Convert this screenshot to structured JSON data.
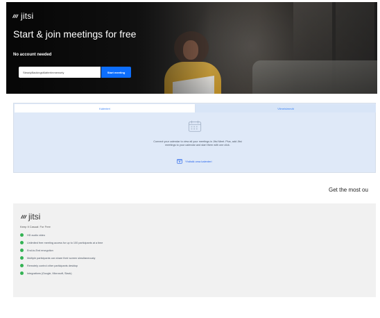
{
  "hero": {
    "brand": "jitsi",
    "title": "Start & join meetings for free",
    "subtitle": "No account needed",
    "meeting_value": "SteadyBackingsMatterImmensely",
    "start_label": "Start meeting"
  },
  "calendar_panel": {
    "tabs": [
      {
        "label": "Kalenteri",
        "active": true
      },
      {
        "label": "Viimeisimmät",
        "active": false
      }
    ],
    "message": "Connect your calendar to view all your meetings in Jitsi Meet. Plus, add Jitsi meetings to your calendar and start them with one click.",
    "connect_label": "Yhdistä oma kalenteri",
    "accent_color": "#2563eb"
  },
  "promo": {
    "heading": "Get the most ou"
  },
  "features": {
    "brand": "jitsi",
    "caption": "Keep It Casual: For Free",
    "items": [
      "HD audio video",
      "Unlimited free meeting access for up to 100 participants at a time",
      "End-to-End encryption",
      "Multiple participants can share their screen simultaneously",
      "Remotely control other participants desktop",
      "Integrations (Google, Microsoft, Slack)"
    ],
    "bullet_color": "#34b354"
  }
}
